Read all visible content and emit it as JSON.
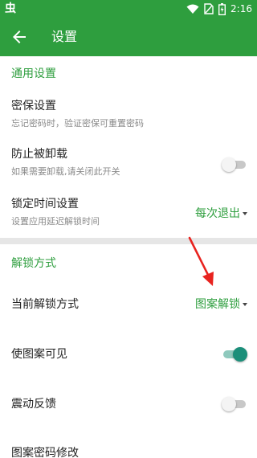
{
  "status_bar": {
    "app_glyph": "虫",
    "time": "2:16",
    "icons": [
      "wifi-icon",
      "no-sim-icon",
      "battery-charging-icon"
    ]
  },
  "toolbar": {
    "title": "设置",
    "back_icon": "back-arrow-icon"
  },
  "colors": {
    "brand": "#2e9e3e",
    "switch_on": "#1b8f7a",
    "annotation": "#e8231f"
  },
  "general": {
    "header": "通用设置",
    "password_protection": {
      "title": "密保设置",
      "subtitle": "忘记密码时，验证密保可重置密码"
    },
    "prevent_uninstall": {
      "title": "防止被卸载",
      "subtitle": "如果需要卸载,请关闭此开关",
      "enabled": false
    },
    "lock_time": {
      "title": "锁定时间设置",
      "subtitle": "设置应用延迟解锁时间",
      "value": "每次退出"
    }
  },
  "unlock": {
    "header": "解锁方式",
    "current_method": {
      "title": "当前解锁方式",
      "value": "图案解锁"
    },
    "pattern_visible": {
      "title": "使图案可见",
      "enabled": true
    },
    "vibration_feedback": {
      "title": "震动反馈",
      "enabled": false
    },
    "change_pattern": {
      "title": "图案密码修改"
    }
  }
}
